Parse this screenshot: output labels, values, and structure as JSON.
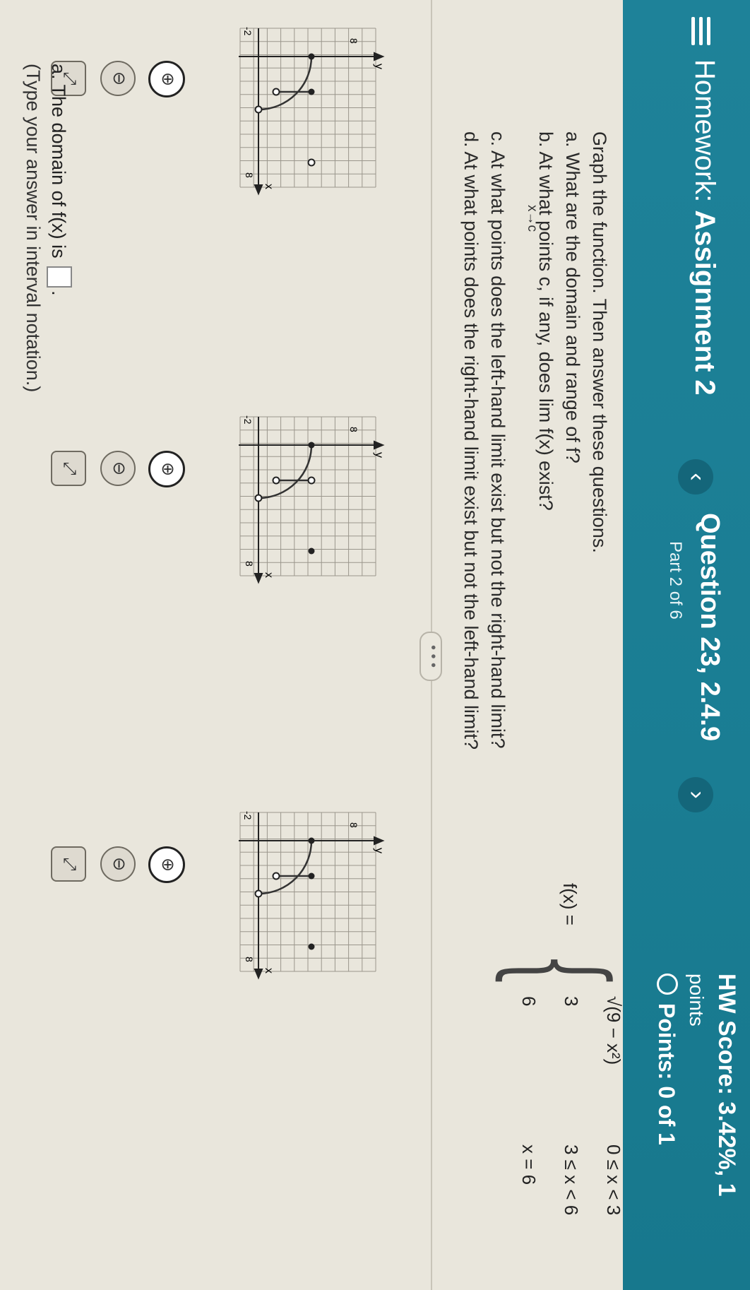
{
  "header": {
    "menu_icon": "hamburger-menu-icon",
    "hw_prefix": "Homework:",
    "hw_name": "Assignment 2",
    "question_title": "Question 23, 2.4.9",
    "part": "Part 2 of 6",
    "prev_symbol": "‹",
    "next_symbol": "›",
    "hw_score": "HW Score: 3.42%, 1",
    "points_word": "points",
    "points": "Points: 0 of 1"
  },
  "question": {
    "intro": "Graph the function. Then answer these questions.",
    "a": "a. What are the domain and range of f?",
    "b": "b. At what points c, if any, does  lim f(x) exist?",
    "b_sub": "x→c",
    "c": "c. At what points does the left-hand limit exist but not the right-hand limit?",
    "d": "d. At what points does the right-hand limit exist but not the left-hand limit?"
  },
  "function": {
    "label": "f(x) =",
    "cases": [
      {
        "expr": "√(9 − x²)",
        "cond": "0 ≤ x < 3"
      },
      {
        "expr": "3",
        "cond": "3 ≤ x < 6"
      },
      {
        "expr": "6",
        "cond": "x = 6"
      }
    ]
  },
  "more_button": "• • •",
  "graphs": [
    {
      "axis_y": "y",
      "axis_x": "x",
      "tick_max": "8",
      "tick_min": "-2"
    },
    {
      "axis_y": "y",
      "axis_x": "x",
      "tick_max": "8",
      "tick_min": "-2"
    },
    {
      "axis_y": "y",
      "axis_x": "x",
      "tick_max": "8",
      "tick_min": "-2"
    }
  ],
  "tools": {
    "zoom_in_icon": "zoom-in-icon",
    "zoom_out_icon": "zoom-out-icon",
    "expand_icon": "expand-icon",
    "zoom_in_glyph": "⊕",
    "zoom_out_glyph": "⊖",
    "expand_glyph": "⤢"
  },
  "answer": {
    "prompt": "a. The domain of f(x) is",
    "suffix": ".",
    "hint": "(Type your answer in interval notation.)"
  },
  "colors": {
    "header": "#1a7d93",
    "page_bg": "#e9e6dc",
    "graph_stroke": "#333333"
  }
}
